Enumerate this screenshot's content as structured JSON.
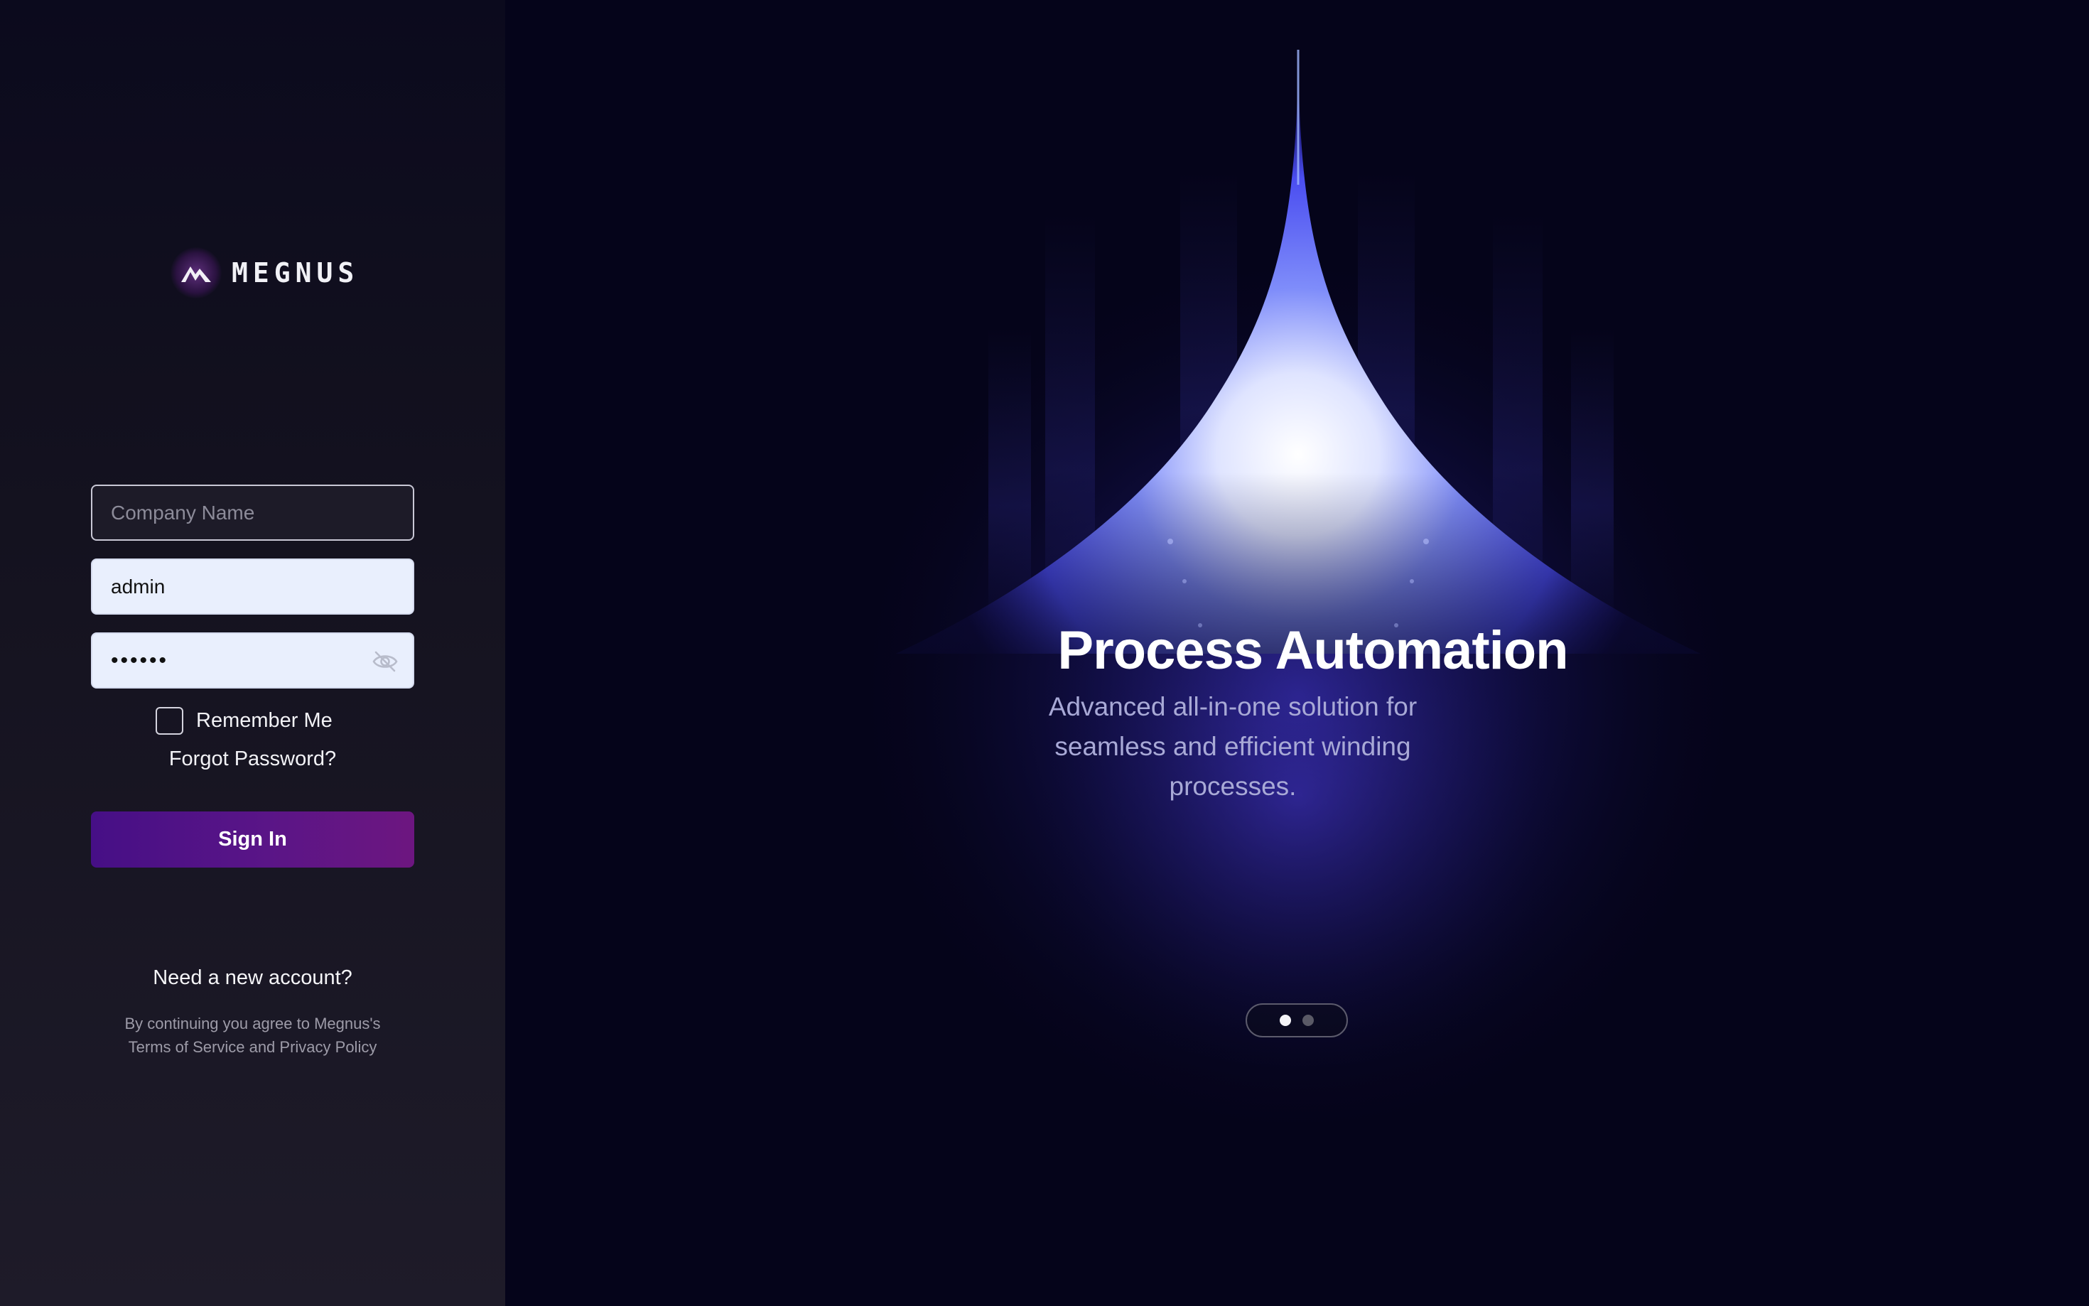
{
  "brand": {
    "name": "MEGNUS"
  },
  "login": {
    "company_placeholder": "Company Name",
    "company_value": "",
    "username_value": "admin",
    "password_value": "••••••",
    "remember_label": "Remember Me",
    "remember_checked": false,
    "forgot_label": "Forgot Password?",
    "signin_label": "Sign In",
    "need_account_label": "Need a new account?",
    "terms_line1": "By continuing you agree to Megnus's",
    "terms_line2": "Terms of Service and Privacy Policy"
  },
  "hero": {
    "title": "Process Automation",
    "subtitle": "Advanced all-in-one solution for seamless and efficient winding processes.",
    "slides": {
      "count": 2,
      "active": 1
    }
  },
  "colors": {
    "background": "#05041a",
    "accent_start": "#460f86",
    "accent_end": "#6d1680",
    "glow": "#4a4df0"
  },
  "icons": {
    "eye_toggle": "eye-off-icon",
    "logo": "mountain-logo-icon"
  }
}
